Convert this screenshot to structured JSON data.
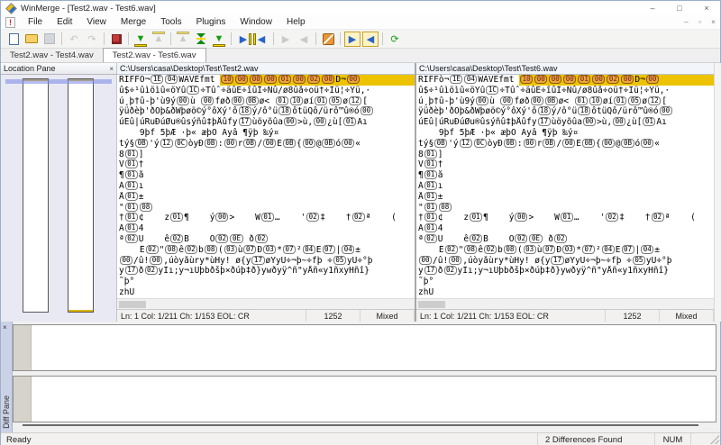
{
  "window": {
    "title": "WinMerge - [Test2.wav - Test6.wav]"
  },
  "menu": {
    "items": [
      "File",
      "Edit",
      "View",
      "Merge",
      "Tools",
      "Plugins",
      "Window",
      "Help"
    ]
  },
  "toolbar": {
    "items": [
      {
        "name": "new-document-icon",
        "kind": "page",
        "enabled": true
      },
      {
        "name": "open-icon",
        "kind": "folder",
        "enabled": true
      },
      {
        "name": "save-icon",
        "kind": "floppy",
        "enabled": false
      },
      {
        "sep": true
      },
      {
        "name": "undo-icon",
        "glyph": "↶",
        "color": "#a0a0a0",
        "enabled": false
      },
      {
        "name": "redo-icon",
        "glyph": "↷",
        "color": "#a0a0a0",
        "enabled": false
      },
      {
        "sep": true
      },
      {
        "name": "options-icon",
        "kind": "redbox",
        "enabled": true
      },
      {
        "sep": true
      },
      {
        "name": "next-difference-icon",
        "glyph": "▼",
        "color": "#12a012",
        "bar": "bottom",
        "enabled": true
      },
      {
        "name": "previous-difference-icon",
        "glyph": "▲",
        "color": "#a8a8a8",
        "bar": "top",
        "enabled": false
      },
      {
        "sep": true
      },
      {
        "name": "first-difference-icon",
        "glyph": "▲",
        "color": "#a8a8a8",
        "bar": "top",
        "enabled": false
      },
      {
        "name": "current-difference-icon",
        "kind": "hourglass",
        "enabled": true
      },
      {
        "name": "last-difference-icon",
        "glyph": "▼",
        "color": "#12a012",
        "bar": "bottom",
        "enabled": true
      },
      {
        "sep": true
      },
      {
        "name": "copy-right-icon",
        "glyph": "▶",
        "color": "#2863c8",
        "bar": "right",
        "enabled": true
      },
      {
        "name": "copy-left-icon",
        "glyph": "◀",
        "color": "#2863c8",
        "bar": "left",
        "enabled": true
      },
      {
        "sep": true
      },
      {
        "name": "copy-right-and-advance-icon",
        "glyph": "▶",
        "color": "#a8a8a8",
        "enabled": false
      },
      {
        "name": "copy-left-and-advance-icon",
        "glyph": "◀",
        "color": "#a8a8a8",
        "enabled": false
      },
      {
        "sep": true
      },
      {
        "name": "plugin-settings-icon",
        "kind": "wrench",
        "enabled": true
      },
      {
        "sep": true
      },
      {
        "name": "next-file-icon",
        "glyph": "▶",
        "color": "#2863c8",
        "boxed": true,
        "enabled": true
      },
      {
        "name": "previous-file-icon",
        "glyph": "◀",
        "color": "#2863c8",
        "boxed": true,
        "enabled": true
      },
      {
        "sep": true
      },
      {
        "name": "refresh-icon",
        "glyph": "⟳",
        "color": "#18a018",
        "enabled": true
      }
    ]
  },
  "tabs": [
    {
      "label": "Test2.wav - Test4.wav",
      "active": false
    },
    {
      "label": "Test2.wav - Test6.wav",
      "active": true
    }
  ],
  "location_pane": {
    "title": "Location Pane",
    "close_label": "×"
  },
  "panes": [
    {
      "path": "C:\\Users\\casa\\Desktop\\Test\\Test2.wav",
      "status": {
        "position": "Ln: 1  Col: 1/211  Ch: 1/153  EOL: CR",
        "encoding": "1252",
        "eol": "Mixed"
      },
      "lines": [
        "RIFFÔ¬{1E}{04}WAVEfmt ⟦{10}{00}{00}{00}{01}{00}{02}{00}D¬{00}⟧",
        "û$÷¹ûìöìû«öYû{1C}÷Tûˆ÷äûË÷îûÎ÷Ñû/ø8ûå÷oü†÷Ïü¦÷Ýü,·",
        "ú¸þ†û-þ'ù9ý{00}ù {00}føð{00}{0B}ø< {01}{10}øí{01}{05}ø{12}[",
        "ÿüðèþ'ðÓþ&ðWþøö©ý°ôXý'ô{18}ý/ô°ü{18}ôtüQô/ürô™û®ó{00}",
        "úÈû|úRuÐúØu®ûsýñû‡þÅûfy{17}ùöyõûa{00}>ù‚{00}¿ù[{01}Ãı",
        "    9þf 5þÆ ·þ« æþÒ Ayâ ¶ÿþ ‰ý¤",
        "tý§{0B}'ý{12}{0C}òyÐ{0B}:{00}r{0B}/{00}E{0B}{{00}@{0B}ó{00}«",
        "8{01}]",
        "V{01}†",
        "¶{01}å",
        "Á{01}ı",
        "Å{01}±",
        "\"{01}{08}",
        "†{01}¢    z{01}¶    ý{00}>    W{01}…    '{02}‡    †{02}ª    (",
        "Ã{01}4",
        "ª{02}Ù    ê{02}B    Ô{02}{0E} ð{02}",
        "    Ê{02}\"{08}ê{02}b{08}({03}ù{07}Ð{03}*{07}²{04}E{07}|{04}±",
        "{00}/û!{00},úòyåùry*ùHy! ø{y{17}øYyÛ÷¬þ~÷fþ ÷{05}yU÷°þ",
        "y{17}ð{02}yÏı;y¬ıÜþbðšþ×ðúþ‡ð}ywðyÿ^ñ\"yÅñ«y1ñxyHñî}",
        "˜þ°",
        "zhÛ"
      ]
    },
    {
      "path": "C:\\Users\\casa\\Desktop\\Test\\Test6.wav",
      "status": {
        "position": "Ln: 1  Col: 1/211  Ch: 1/153  EOL: CR",
        "encoding": "1252",
        "eol": "Mixed"
      },
      "lines": [
        "RIFFò¬{1E}{04}WAVEfmt ⟦{10}{00}{00}{00}{01}{00}{02}{00}D¬{00}⟧",
        "û$÷¹ûìöìû«öYû{1C}÷Tûˆ÷äûË÷îûÎ÷Ñû/ø8ûå÷oü†÷Ïü¦÷Ýü,·",
        "ú¸þ†û-þ'ù9ý{00}ù {00}føð{00}{0B}ø< {01}{10}øí{01}{05}ø{12}[",
        "ÿüðèþ'ðÓþ&ðWþøö©ý°ôXý'ô{18}ý/ô°ü{18}ôtüQô/ürô™û®ó{00}",
        "úÈû|úRuÐúØu®ûsýñû‡þÅûfy{17}ùöyõûa{00}>ù‚{00}¿ù[{01}Ãı",
        "    9þf 5þÆ ·þ« æþÒ Ayâ ¶ÿþ ‰ý¤",
        "tý§{0B}'ý{12}{0C}òyÐ{0B}:{00}r{0B}/{00}E{0B}{{00}@{0B}ó{00}«",
        "8{01}]",
        "V{01}†",
        "¶{01}å",
        "Á{01}ı",
        "Å{01}±",
        "\"{01}{08}",
        "†{01}¢    z{01}¶    ý{00}>    W{01}…    '{02}‡    †{02}ª    (",
        "Ã{01}4",
        "ª{02}Ù    ê{02}B    Ô{02}{0E} ð{02}",
        "    Ê{02}\"{08}ê{02}b{08}({03}ù{07}Ð{03}*{07}²{04}E{07}|{04}±",
        "{00}/û!{00},úòyåùry*ùHy! ø{y{17}øYyÛ÷¬þ~÷fþ ÷{05}yU÷°þ",
        "y{17}ð{02}yÏı;y¬ıÜþbðšþ×ðúþ‡ð}ywðyÿ^ñ\"yÅñ«y1ñxyHñî}",
        "˜þ°",
        "zhÛ"
      ]
    }
  ],
  "diff_pane": {
    "title": "Diff Pane",
    "close_label": "×"
  },
  "statusbar": {
    "left": "Ready",
    "diffs": "2 Differences Found",
    "keyboard": "NUM"
  },
  "window_controls": {
    "minimize": "–",
    "maximize": "□",
    "close": "×"
  },
  "colors": {
    "diff_highlight": "#edc301",
    "diff_control_box": "#eaa83b",
    "location_pane_bg": "#e9e9f4",
    "location_tick": "#e0b400",
    "location_view_band": "#8290e8"
  }
}
